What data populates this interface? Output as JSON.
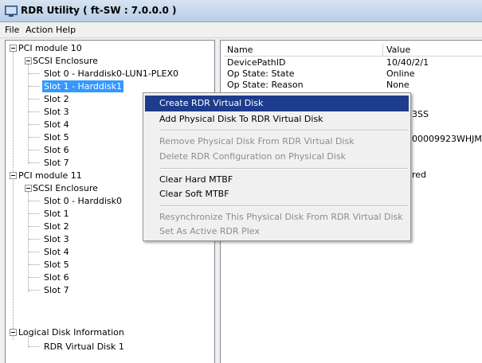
{
  "window": {
    "title": "RDR Utility  ( ft-SW : 7.0.0.0 )"
  },
  "menubar": {
    "items": [
      "File",
      "Action",
      "Help"
    ]
  },
  "tree": {
    "nodes": [
      "PCI module 10",
      "SCSI Enclosure",
      "Slot 0  -  Harddisk0-LUN1-PLEX0",
      "Slot 1  -  Harddisk1",
      "Slot 2",
      "Slot 3",
      "Slot 4",
      "Slot 5",
      "Slot 6",
      "Slot 7",
      "PCI module 11",
      "SCSI Enclosure",
      "Slot 0  -  Harddisk0",
      "Slot 1",
      "Slot 2",
      "Slot 3",
      "Slot 4",
      "Slot 5",
      "Slot 6",
      "Slot 7",
      "Logical Disk Information",
      "RDR Virtual Disk 1"
    ]
  },
  "list": {
    "headers": [
      "Name",
      "Value"
    ],
    "rows": [
      {
        "name": "DevicePathID",
        "value": "10/40/2/1"
      },
      {
        "name": "Op State: State",
        "value": "Online"
      },
      {
        "name": "Op State: Reason",
        "value": "None"
      }
    ],
    "partial_values": [
      "3SS",
      "00009923WHJM",
      "red"
    ]
  },
  "context_menu": {
    "items": [
      {
        "label": "Create RDR Virtual Disk",
        "enabled": true
      },
      {
        "label": "Add Physical Disk To RDR Virtual Disk",
        "enabled": true
      },
      {
        "label": "Remove Physical Disk From RDR Virtual Disk",
        "enabled": false
      },
      {
        "label": "Delete RDR Configuration on Physical Disk",
        "enabled": false
      },
      {
        "label": "Clear Hard MTBF",
        "enabled": true
      },
      {
        "label": "Clear Soft MTBF",
        "enabled": true
      },
      {
        "label": "Resynchronize This Physical Disk From RDR Virtual Disk",
        "enabled": false
      },
      {
        "label": "Set As Active RDR Plex",
        "enabled": false
      }
    ]
  },
  "colors": {
    "selection": "#3399ff",
    "menu_highlight": "#1e3c8c",
    "disabled_text": "#8d8d8d"
  }
}
